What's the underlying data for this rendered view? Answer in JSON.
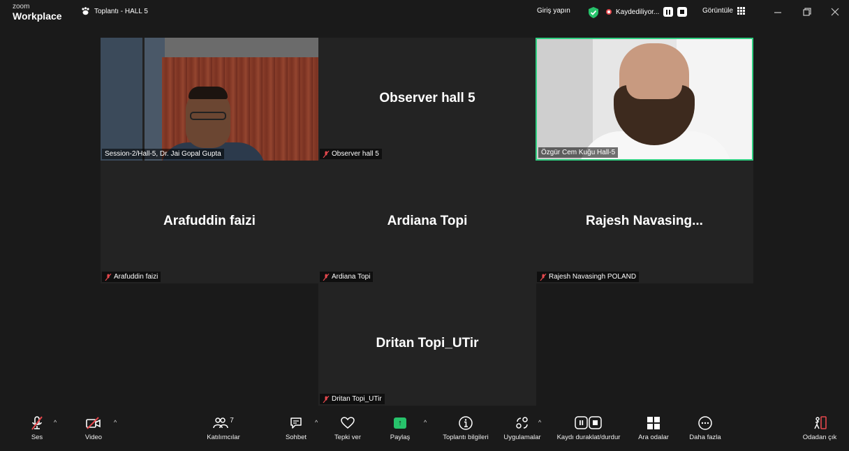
{
  "titlebar": {
    "brand_small": "zoom",
    "brand_big": "Workplace",
    "meeting_title": "Toplantı - HALL 5",
    "sign_in": "Giriş yapın",
    "recording_status": "Kaydediliyor...",
    "view_label": "Görüntüle",
    "icons": {
      "meeting": "paw-icon",
      "security": "shield-check-icon",
      "view": "grid-icon"
    }
  },
  "tiles": [
    {
      "display_name": "",
      "label": "Session-2/Hall-5, Dr. Jai Gopal Gupta",
      "has_video": true,
      "muted": false
    },
    {
      "display_name": "Observer hall 5",
      "label": "Observer hall 5",
      "has_video": false,
      "muted": true
    },
    {
      "display_name": "",
      "label": "Özgür Cem Kuğu Hall-5",
      "has_video": true,
      "muted": false,
      "active_speaker": true
    },
    {
      "display_name": "Arafuddin faizi",
      "label": "Arafuddin faizi",
      "has_video": false,
      "muted": true
    },
    {
      "display_name": "Ardiana Topi",
      "label": "Ardiana Topi",
      "has_video": false,
      "muted": true
    },
    {
      "display_name": "Rajesh  Navasing...",
      "label": "Rajesh Navasingh POLAND",
      "has_video": false,
      "muted": true
    },
    {
      "display_name": "Dritan Topi_UTir",
      "label": "Dritan Topi_UTir",
      "has_video": false,
      "muted": true
    }
  ],
  "toolbar": {
    "audio": "Ses",
    "video": "Video",
    "participants": "Katılımcılar",
    "participants_count": "7",
    "chat": "Sohbet",
    "react": "Tepki ver",
    "share": "Paylaş",
    "meeting_info": "Toplantı bilgileri",
    "apps": "Uygulamalar",
    "record_control": "Kaydı duraklat/durdur",
    "breakout_rooms": "Ara odalar",
    "more": "Daha fazla",
    "leave": "Odadan çık"
  },
  "colors": {
    "active_border": "#2fcf81",
    "muted_red": "#e5484d",
    "share_green": "#27c26b",
    "background": "#1a1a1a",
    "tile_bg": "#232323"
  }
}
